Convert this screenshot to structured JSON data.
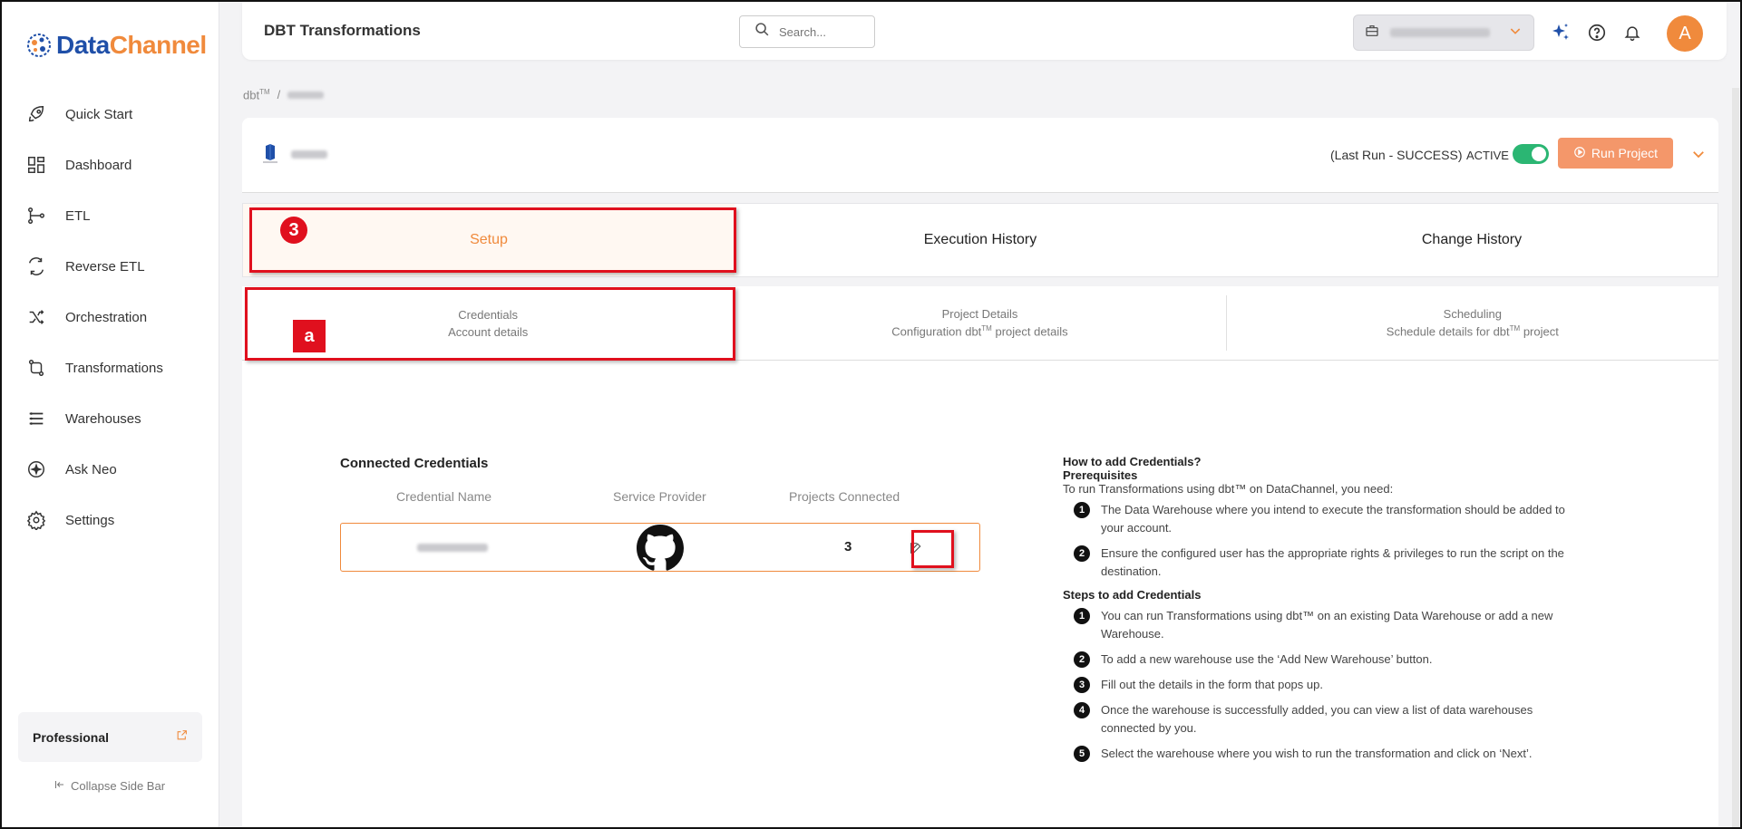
{
  "brand": {
    "name_part1": "Data",
    "name_part2": "Channel",
    "primary": "#1f4fa8",
    "accent": "#f08a3c"
  },
  "sidebar": {
    "items": [
      {
        "label": "Quick Start",
        "icon": "rocket-icon"
      },
      {
        "label": "Dashboard",
        "icon": "dashboard-icon"
      },
      {
        "label": "ETL",
        "icon": "etl-icon"
      },
      {
        "label": "Reverse ETL",
        "icon": "reverse-etl-icon"
      },
      {
        "label": "Orchestration",
        "icon": "orchestration-icon"
      },
      {
        "label": "Transformations",
        "icon": "transformations-icon"
      },
      {
        "label": "Warehouses",
        "icon": "warehouses-icon"
      },
      {
        "label": "Ask Neo",
        "icon": "sparkle-icon"
      },
      {
        "label": "Settings",
        "icon": "gear-icon"
      }
    ],
    "plan_label": "Professional",
    "collapse_label": "Collapse Side Bar"
  },
  "header": {
    "title": "DBT Transformations",
    "search_placeholder": "Search...",
    "avatar_initial": "A"
  },
  "breadcrumb": {
    "root": "dbt",
    "root_sup": "TM",
    "separator": "/"
  },
  "project": {
    "last_run": "(Last Run - SUCCESS)",
    "status_label": "ACTIVE",
    "run_button": "Run Project"
  },
  "tabs": [
    {
      "label": "Setup",
      "active": true
    },
    {
      "label": "Execution History",
      "active": false
    },
    {
      "label": "Change History",
      "active": false
    }
  ],
  "subtabs": [
    {
      "title": "Credentials",
      "subtitle_pre": "Account details",
      "subtitle_sup": "",
      "subtitle_post": ""
    },
    {
      "title": "Project Details",
      "subtitle_pre": "Configuration dbt",
      "subtitle_sup": "TM",
      "subtitle_post": " project details"
    },
    {
      "title": "Scheduling",
      "subtitle_pre": "Schedule details for dbt",
      "subtitle_sup": "TM",
      "subtitle_post": " project"
    }
  ],
  "credentials": {
    "title": "Connected Credentials",
    "columns": [
      "Credential Name",
      "Service Provider",
      "Projects Connected"
    ],
    "rows": [
      {
        "provider_icon": "github-icon",
        "projects_connected": "3"
      }
    ]
  },
  "help": {
    "title": "How to add Credentials?",
    "prereq_title": "Prerequisites",
    "prereq_intro": "To run Transformations using dbt™ on DataChannel, you need:",
    "prereqs": [
      "The Data Warehouse where you intend to execute the transformation should be added to your account.",
      "Ensure the configured user has the appropriate rights & privileges to run the script on the destination."
    ],
    "steps_title": "Steps to add Credentials",
    "steps": [
      "You can run Transformations using dbt™ on an existing Data Warehouse or add a new Warehouse.",
      "To add a new warehouse use the ‘Add New Warehouse’ button.",
      "Fill out the details in the form that pops up.",
      "Once the warehouse is successfully added, you can view a list of data warehouses connected by you.",
      "Select the warehouse where you wish to run the transformation and click on ‘Next’."
    ]
  },
  "annotations": {
    "step_marker": "3",
    "sub_marker": "a",
    "color": "#e0101e"
  }
}
